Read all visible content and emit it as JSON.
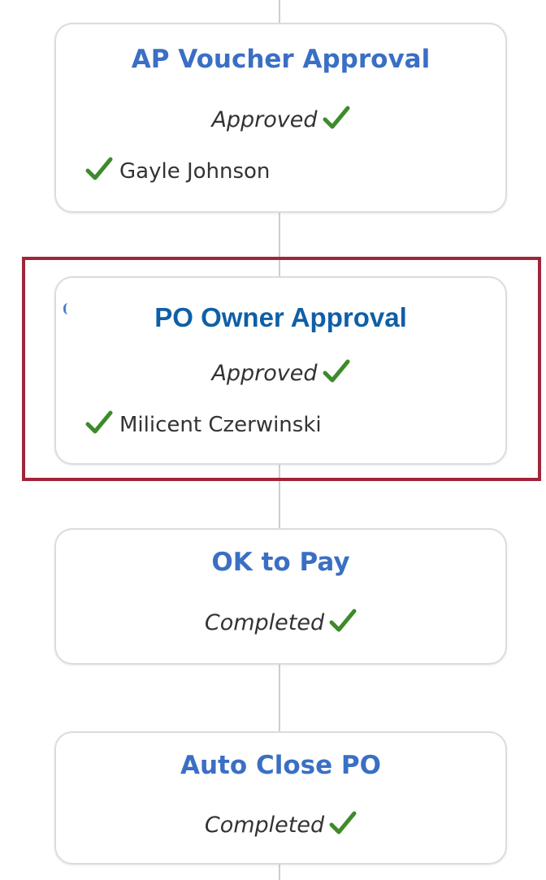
{
  "workflow": {
    "steps": [
      {
        "title": "AP Voucher Approval",
        "status": "Approved",
        "approver": "Gayle Johnson"
      },
      {
        "title": "PO Owner Approval",
        "status": "Approved",
        "approver": "Milicent Czerwinski",
        "highlighted": true
      },
      {
        "title": "OK to Pay",
        "status": "Completed"
      },
      {
        "title": "Auto Close PO",
        "status": "Completed"
      }
    ]
  },
  "icons": {
    "status": "check-icon"
  },
  "colors": {
    "title": "#3a6fc4",
    "highlight_title": "#0f5fa6",
    "check": "#3d8b2a",
    "highlight_border": "#a0243a"
  }
}
